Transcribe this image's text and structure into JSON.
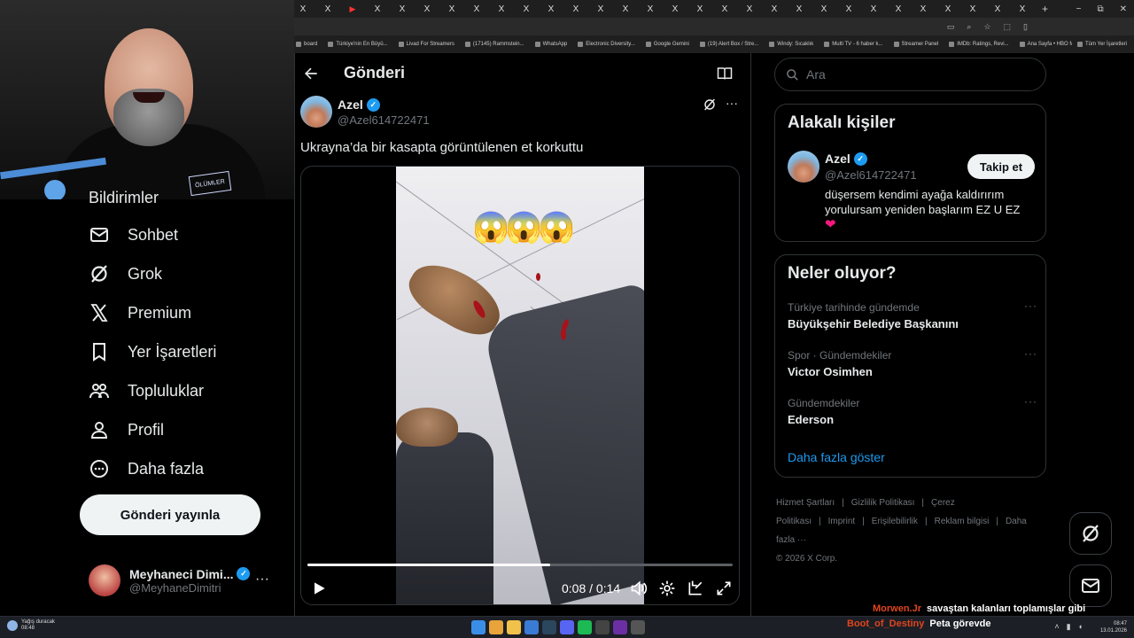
{
  "browser": {
    "tabs": [
      "X",
      "X",
      "▶",
      "X",
      "X",
      "X",
      "X",
      "X",
      "X",
      "X",
      "X",
      "X",
      "X",
      "X",
      "X",
      "X",
      "X",
      "X",
      "X",
      "X",
      "X",
      "X",
      "X",
      "X",
      "X",
      "X",
      "X",
      "X",
      "X",
      "X"
    ],
    "new_tab": "+",
    "window_controls": [
      "−",
      "⧉",
      "✕"
    ],
    "bookmarks": [
      "board",
      "Türkiye'nin En Büyü...",
      "Livad For Streamers",
      "(17145) Rammstein...",
      "WhatsApp",
      "Electronic Diversity...",
      "Google Gemini",
      "(19) Alert Box / Stre...",
      "Windy: Sıcaklık",
      "Multi TV - 6 haber k...",
      "Streamer Panel",
      "IMDb: Ratings, Revi...",
      "Ana Sayfa • HBO Max"
    ],
    "all_bookmarks": "Tüm Yer İşaretleri"
  },
  "webcam": {
    "logo_text": "ÖLÜMLER"
  },
  "nav": {
    "partial_item": "Bildirimler",
    "items": [
      {
        "label": "Sohbet",
        "icon": "mail-icon"
      },
      {
        "label": "Grok",
        "icon": "grok-icon"
      },
      {
        "label": "Premium",
        "icon": "x-logo-icon"
      },
      {
        "label": "Yer İşaretleri",
        "icon": "bookmark-icon"
      },
      {
        "label": "Topluluklar",
        "icon": "communities-icon"
      },
      {
        "label": "Profil",
        "icon": "profile-icon"
      },
      {
        "label": "Daha fazla",
        "icon": "more-circle-icon"
      }
    ],
    "post_button": "Gönderi yayınla",
    "profile": {
      "name": "Meyhaneci Dimi...",
      "handle": "@MeyhaneDimitri",
      "more": "···"
    }
  },
  "post": {
    "header_title": "Gönderi",
    "author_name": "Azel",
    "author_handle": "@Azel614722471",
    "more": "···",
    "text": "Ukrayna’da bir kasapta görüntülenen et korkuttu",
    "emojis": [
      "😱",
      "😱",
      "😱"
    ],
    "video": {
      "current_time": "0:08",
      "duration": "0:14",
      "time_label": "0:08 / 0:14",
      "progress": 0.5714
    }
  },
  "sidebar": {
    "search_placeholder": "Ara",
    "related": {
      "title": "Alakalı kişiler",
      "name": "Azel",
      "handle": "@Azel614722471",
      "follow_label": "Takip et",
      "bio": "düşersem kendimi ayağa kaldırırım yorulursam yeniden başlarım EZ U EZ",
      "heart": "❤"
    },
    "trends": {
      "title": "Neler oluyor?",
      "items": [
        {
          "meta": "Türkiye tarihinde gündemde",
          "name": "Büyükşehir Belediye Başkanını"
        },
        {
          "meta": "Spor · Gündemdekiler",
          "name": "Victor Osimhen"
        },
        {
          "meta": "Gündemdekiler",
          "name": "Ederson"
        }
      ],
      "more": "···",
      "show_more": "Daha fazla göster"
    },
    "footer": {
      "links": [
        "Hizmet Şartları",
        "|",
        "Gizlilik Politikası",
        "|",
        "Çerez Politikası",
        "|",
        "Imprint",
        "|",
        "Erişilebilirlik",
        "|",
        "Reklam bilgisi",
        "|",
        "Daha fazla ···"
      ],
      "copyright": "© 2026 X Corp."
    }
  },
  "chat": [
    {
      "user": "Morwen.Jr",
      "message": "savaştan kalanları toplamışlar gibi"
    },
    {
      "user": "Boot_of_Destiny",
      "message": "Peta görevde"
    }
  ],
  "taskbar": {
    "weather_line1": "Yağış duracak",
    "weather_line2": "08:48",
    "time": "08:47",
    "date": "13.01.2026"
  },
  "colors": {
    "accent": "#1d9bf0",
    "text": "#e7e9ea",
    "muted": "#71767b",
    "border": "#2f3336",
    "chat_user": "#e0451f"
  }
}
